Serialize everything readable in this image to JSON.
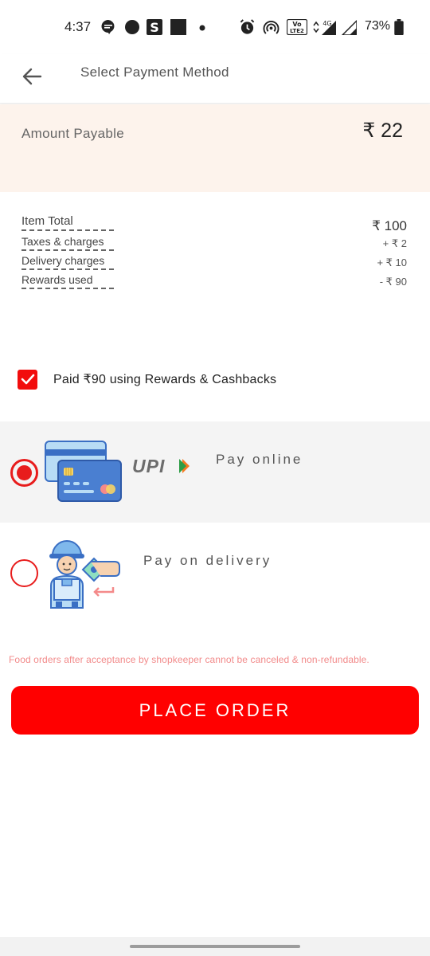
{
  "status_bar": {
    "time": "4:37",
    "battery": "73%",
    "network": "4G",
    "volte": "VoLTE 2"
  },
  "header": {
    "title": "Select Payment Method"
  },
  "amount": {
    "label": "Amount Payable",
    "value": "₹ 22"
  },
  "breakdown": [
    {
      "label": "Item Total",
      "value": "₹ 100"
    },
    {
      "label": "Taxes & charges",
      "value": "+ ₹ 2"
    },
    {
      "label": "Delivery charges",
      "value": "+ ₹ 10"
    },
    {
      "label": "Rewards used",
      "value": "- ₹ 90"
    }
  ],
  "rewards": {
    "text": "Paid ₹90 using Rewards & Cashbacks",
    "checked": true
  },
  "payment_options": {
    "online": {
      "label": "Pay online",
      "logo_text": "UPI",
      "selected": true
    },
    "delivery": {
      "label": "Pay on delivery",
      "selected": false
    }
  },
  "disclaimer": "Food orders after acceptance by shopkeeper cannot be canceled & non-refundable.",
  "place_order_label": "PLACE ORDER",
  "colors": {
    "accent": "#ff0000",
    "amount_band": "#fdf3ec",
    "disclaimer": "#f28a8a"
  }
}
